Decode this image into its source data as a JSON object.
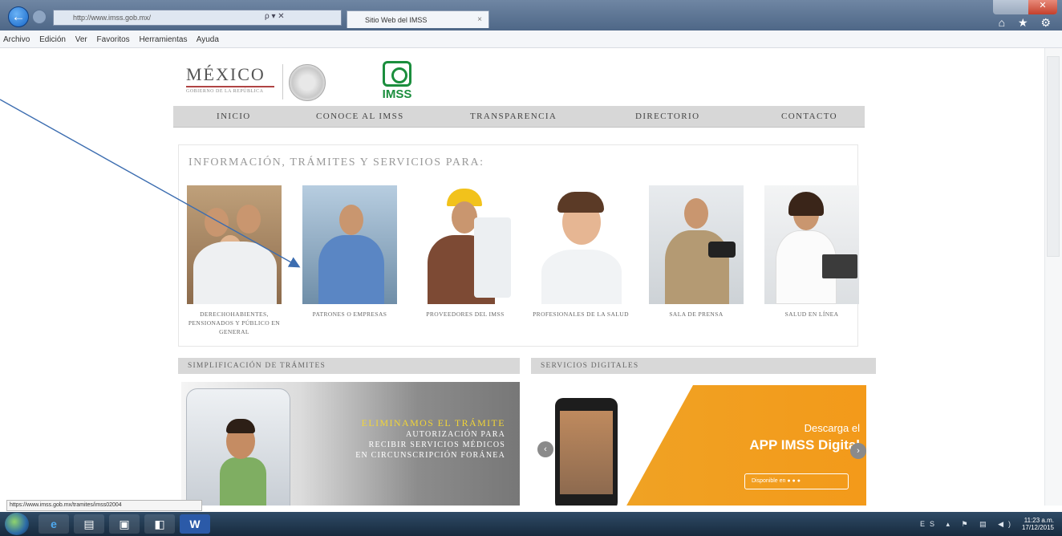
{
  "browser": {
    "address": "http://www.imss.gob.mx/",
    "tab_title": "Sitio Web del IMSS",
    "tab_close": "×",
    "search_controls": "ρ ▾ ✕",
    "win_close": "✕",
    "ie_icons": "⌂ ★ ⚙",
    "menu": [
      "Archivo",
      "Edición",
      "Ver",
      "Favoritos",
      "Herramientas",
      "Ayuda"
    ],
    "status_url": "https://www.imss.gob.mx/tramites/imss02004",
    "back_glyph": "←"
  },
  "header": {
    "mexico_word": "MÉXICO",
    "mexico_sub": "GOBIERNO DE LA REPÚBLICA",
    "imss": "IMSS"
  },
  "nav": [
    "Inicio",
    "Conoce al IMSS",
    "Transparencia",
    "Directorio",
    "Contacto"
  ],
  "panel": {
    "heading": "Información, Trámites y Servicios para:",
    "cards": [
      "Derechohabientes, pensionados y público en general",
      "Patrones o Empresas",
      "Proveedores del IMSS",
      "Profesionales de la salud",
      "Sala de prensa",
      "Salud en línea"
    ]
  },
  "sections": {
    "left_title": "Simplificación de trámites",
    "right_title": "Servicios digitales"
  },
  "banner_left": {
    "line1": "Eliminamos el trámite",
    "line2": "Autorización para",
    "line3": "Recibir Servicios Médicos",
    "line4": "en Circunscripción Foránea"
  },
  "banner_right": {
    "line1": "Descarga el",
    "line2": "APP IMSS Digital",
    "badge": "Disponible en  ",
    "prev": "‹",
    "next": "›"
  },
  "taskbar": {
    "time": "11:23 a.m.",
    "date": "17/12/2015",
    "tray": "ES ▴ ⚑ ▤ ◀)",
    "items": [
      "e",
      "▤",
      "▣",
      "◧",
      "W"
    ]
  },
  "colors": {
    "imss_green": "#1b8e3d",
    "app_orange": "#f39a1a",
    "nav_gray": "#d7d7d7"
  }
}
